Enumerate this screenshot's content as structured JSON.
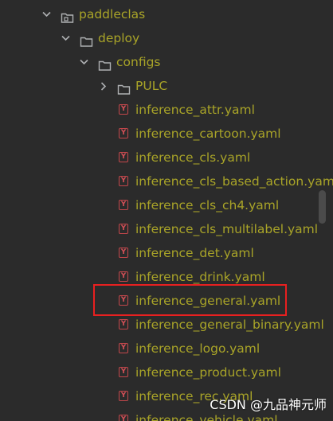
{
  "tree": {
    "nodes": [
      {
        "label": "paddleclas",
        "type": "folder",
        "expanded": true
      },
      {
        "label": "deploy",
        "type": "folder",
        "expanded": true
      },
      {
        "label": "configs",
        "type": "folder",
        "expanded": true
      },
      {
        "label": "PULC",
        "type": "folder",
        "expanded": false
      },
      {
        "label": "inference_attr.yaml",
        "type": "yaml"
      },
      {
        "label": "inference_cartoon.yaml",
        "type": "yaml"
      },
      {
        "label": "inference_cls.yaml",
        "type": "yaml"
      },
      {
        "label": "inference_cls_based_action.yaml",
        "type": "yaml"
      },
      {
        "label": "inference_cls_ch4.yaml",
        "type": "yaml"
      },
      {
        "label": "inference_cls_multilabel.yaml",
        "type": "yaml"
      },
      {
        "label": "inference_det.yaml",
        "type": "yaml"
      },
      {
        "label": "inference_drink.yaml",
        "type": "yaml"
      },
      {
        "label": "inference_general.yaml",
        "type": "yaml",
        "highlighted": true
      },
      {
        "label": "inference_general_binary.yaml",
        "type": "yaml"
      },
      {
        "label": "inference_logo.yaml",
        "type": "yaml"
      },
      {
        "label": "inference_product.yaml",
        "type": "yaml"
      },
      {
        "label": "inference_rec.yaml",
        "type": "yaml"
      },
      {
        "label": "inference_vehicle.yaml",
        "type": "yaml"
      }
    ],
    "yaml_icon_glyph": "Y"
  },
  "icons": {
    "expanded": "chevron-down-icon",
    "collapsed": "chevron-right-icon",
    "folder": "folder-icon",
    "module_folder": "module-folder-icon",
    "yaml": "yaml-file-icon"
  },
  "colors": {
    "background": "#2b2b2b",
    "file_text": "#a9a428",
    "yaml_icon": "#d25057",
    "highlight": "#e82020"
  },
  "watermark": "CSDN @九品神元师"
}
